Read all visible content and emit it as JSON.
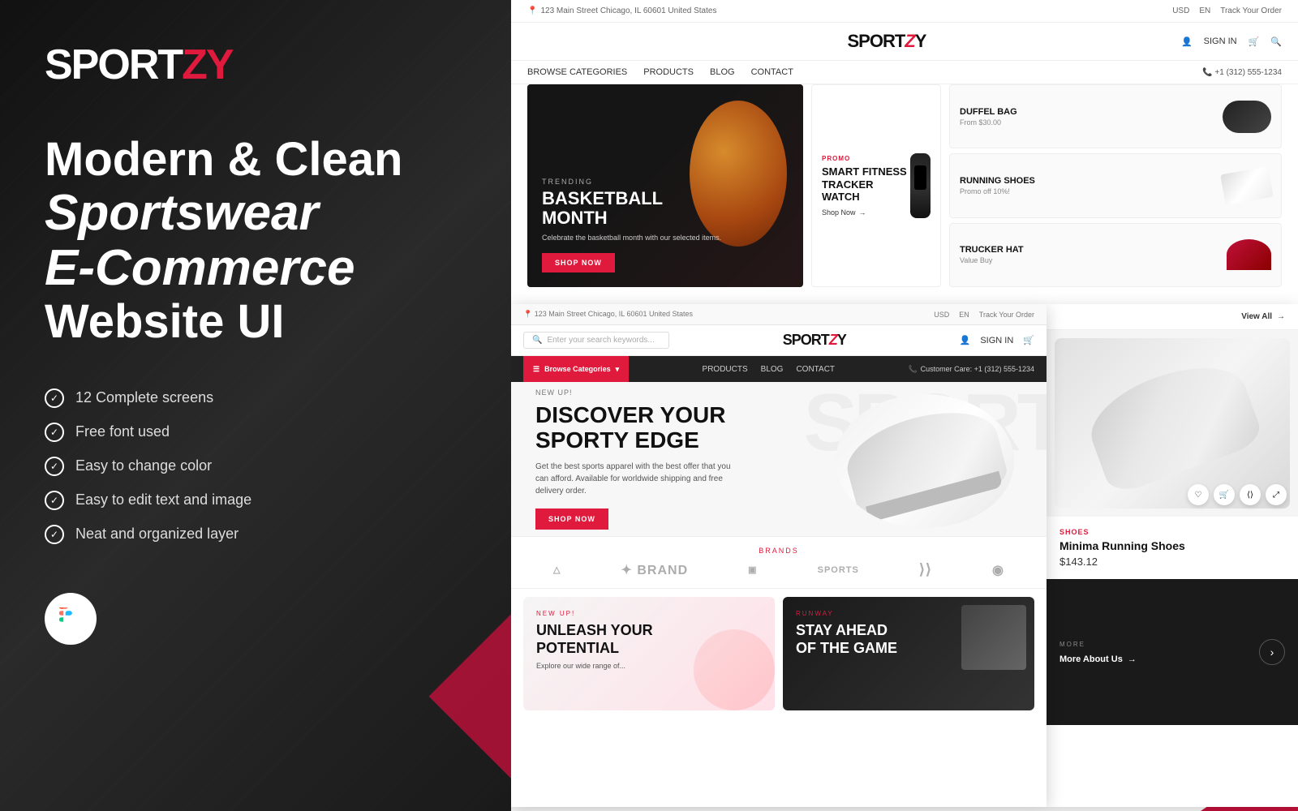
{
  "left": {
    "logo": "SPORT",
    "logo_z": "Z",
    "logo_y": "Y",
    "headline_line1": "Modern & Clean",
    "headline_line2": "Sportswear",
    "headline_line3": "E-Commerce",
    "headline_line4": "Website UI",
    "features": [
      "12 Complete screens",
      "Free font used",
      "Easy to change color",
      "Easy to edit text and image",
      "Neat and organized layer"
    ]
  },
  "site_top": {
    "topbar_address": "123 Main Street Chicago, IL 60601 United States",
    "topbar_currency": "USD",
    "topbar_lang": "EN",
    "topbar_track": "Track Your Order",
    "logo": "SPORT",
    "logo_z": "Z",
    "logo_y": "Y",
    "sign_in": "SIGN IN",
    "nav_browse": "BROWSE CATEGORIES",
    "nav_products": "PRODUCTS",
    "nav_blog": "BLOG",
    "nav_contact": "CONTACT",
    "nav_phone": "+1 (312) 555-1234",
    "hero_trending": "TRENDING",
    "hero_title_line1": "BASKETBALL",
    "hero_title_line2": "MONTH",
    "hero_subtitle": "Celebrate the basketball month with our selected items.",
    "hero_btn": "SHOP NOW",
    "promo_label": "PROMO",
    "promo_title": "SMART FITNESS TRACKER WATCH",
    "promo_shopnow": "Shop Now",
    "product1_name": "DUFFEL BAG",
    "product1_sub": "From $30.00",
    "product2_name": "RUNNING SHOES",
    "product2_sub": "Promo off 10%!",
    "product3_name": "TRUCKER HAT",
    "product3_sub": "Value Buy"
  },
  "site_bottom": {
    "topbar_address": "123 Main Street Chicago, IL 60601 United States",
    "topbar_currency": "USD",
    "topbar_lang": "EN",
    "topbar_track": "Track Your Order",
    "search_placeholder": "Enter your search keywords...",
    "logo": "SPORT",
    "logo_z": "Z",
    "logo_y": "Y",
    "sign_in": "SIGN IN",
    "nav_browse": "Browse Categories",
    "nav_products": "PRODUCTS",
    "nav_blog": "BLOG",
    "nav_contact": "CONTACT",
    "nav_phone": "Customer Care: +1 (312) 555-1234",
    "hero_newtag": "NEW UP!",
    "hero_title_line1": "DISCOVER YOUR",
    "hero_title_line2": "SPORTY EDGE",
    "hero_subtitle": "Get the best sports apparel with the best offer that you can afford. Available for worldwide shipping and free delivery order.",
    "hero_btn": "SHOP NOW",
    "hero_bg_text": "SPORT",
    "brands_label": "BRANDS",
    "brands": [
      "△",
      "✦",
      "□",
      "SPORTS",
      "↙",
      "◌"
    ],
    "promo1_tag": "NEW UP!",
    "promo1_title_line1": "UNLEASH YOUR",
    "promo1_title_line2": "POTENTIAL",
    "promo1_subtitle": "Explore our wide range of...",
    "promo2_tag": "RUNWAY",
    "promo2_title_line1": "STAY AHEAD",
    "promo2_title_line2": "OF THE GAME"
  },
  "product_panel": {
    "view_all": "View All",
    "product_category": "SHOES",
    "product_name": "Minima Running Shoes",
    "product_price": "$143.12",
    "more_about": "More About Us",
    "nav_chevron": "›"
  }
}
